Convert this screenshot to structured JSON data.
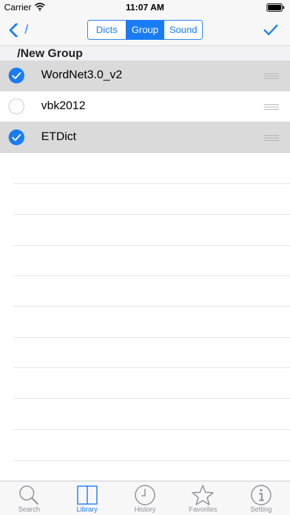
{
  "status_bar": {
    "carrier": "Carrier",
    "time": "11:07 AM"
  },
  "nav": {
    "back_label": "/",
    "segments": [
      {
        "label": "Dicts",
        "selected": false
      },
      {
        "label": "Group",
        "selected": true
      },
      {
        "label": "Sound",
        "selected": false
      }
    ]
  },
  "section": {
    "title": "/New Group"
  },
  "rows": [
    {
      "label": "WordNet3.0_v2",
      "checked": true
    },
    {
      "label": "vbk2012",
      "checked": false
    },
    {
      "label": "ETDict",
      "checked": true
    }
  ],
  "tabs": [
    {
      "label": "Search",
      "icon": "search-icon",
      "active": false
    },
    {
      "label": "Library",
      "icon": "book-icon",
      "active": true
    },
    {
      "label": "History",
      "icon": "clock-icon",
      "active": false
    },
    {
      "label": "Favorites",
      "icon": "star-icon",
      "active": false
    },
    {
      "label": "Setting",
      "icon": "info-icon",
      "active": false
    }
  ],
  "colors": {
    "accent": "#1a7cf5",
    "checked_row_bg": "#dadada"
  }
}
